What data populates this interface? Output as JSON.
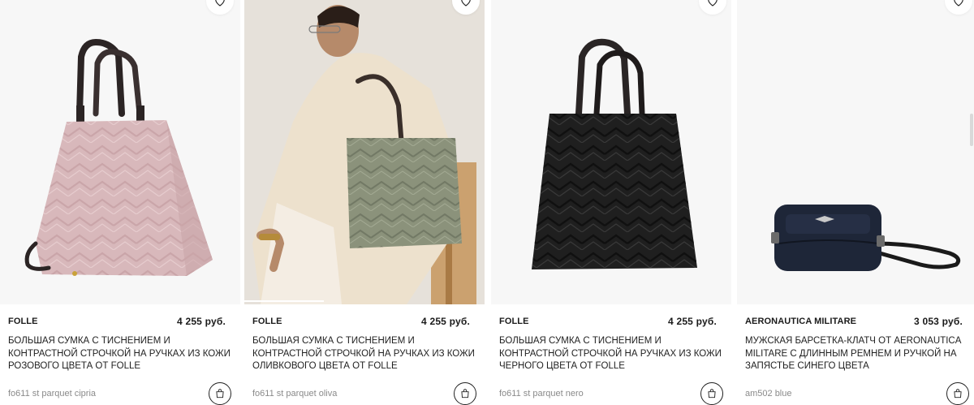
{
  "products": [
    {
      "brand": "FOLLE",
      "price": "4 255 руб.",
      "title": "БОЛЬШАЯ СУМКА С ТИСНЕНИЕМ И КОНТРАСТНОЙ СТРОЧКОЙ НА РУЧКАХ ИЗ КОЖИ РОЗОВОГО ЦВЕТА ОТ FOLLE",
      "sku": "fo611 st parquet cipria",
      "image_color": "#d8b8bb"
    },
    {
      "brand": "FOLLE",
      "price": "4 255 руб.",
      "title": "БОЛЬШАЯ СУМКА С ТИСНЕНИЕМ И КОНТРАСТНОЙ СТРОЧКОЙ НА РУЧКАХ ИЗ КОЖИ ОЛИВКОВОГО ЦВЕТА ОТ FOLLE",
      "sku": "fo611 st parquet oliva",
      "image_color": "#8b927b"
    },
    {
      "brand": "FOLLE",
      "price": "4 255 руб.",
      "title": "БОЛЬШАЯ СУМКА С ТИСНЕНИЕМ И КОНТРАСТНОЙ СТРОЧКОЙ НА РУЧКАХ ИЗ КОЖИ ЧЕРНОГО ЦВЕТА ОТ FOLLE",
      "sku": "fo611 st parquet nero",
      "image_color": "#1f1f1f"
    },
    {
      "brand": "AERONAUTICA MILITARE",
      "price": "3 053 руб.",
      "title": "МУЖСКАЯ БАРСЕТКА-КЛАТЧ ОТ AERONAUTICA MILITARE С ДЛИННЫМ РЕМНЕМ И РУЧКОЙ НА ЗАПЯСТЬЕ СИНЕГО ЦВЕТА",
      "sku": "am502 blue",
      "image_color": "#1e2638"
    }
  ],
  "icons": {
    "favorite": "heart-icon",
    "cart": "shopping-bag-icon"
  }
}
